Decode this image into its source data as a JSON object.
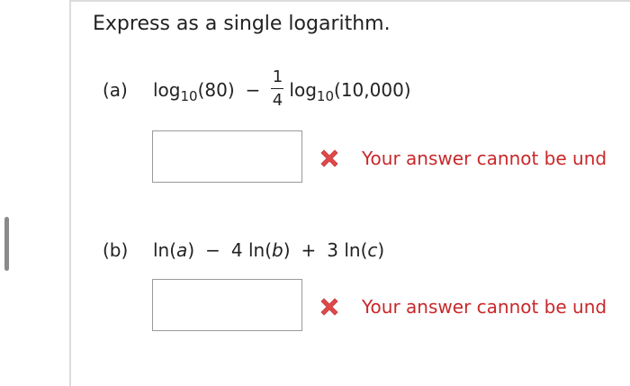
{
  "instruction": "Express as a single logarithm.",
  "problems": [
    {
      "label": "(a)",
      "expr": {
        "fn1": "log",
        "sub1": "10",
        "arg1": "(80)",
        "op": "−",
        "frac_num": "1",
        "frac_den": "4",
        "fn2": "log",
        "sub2": "10",
        "arg2": "(10,000)"
      },
      "answer_value": "",
      "feedback": "Your answer cannot be und"
    },
    {
      "label": "(b)",
      "expr": {
        "t1_fn": "ln(",
        "t1_var": "a",
        "t1_close": ")",
        "op1": "−",
        "t2_coef": "4 ln(",
        "t2_var": "b",
        "t2_close": ")",
        "op2": "+",
        "t3_coef": "3 ln(",
        "t3_var": "c",
        "t3_close": ")"
      },
      "answer_value": "",
      "feedback": "Your answer cannot be und"
    }
  ],
  "colors": {
    "error": "#c8282b",
    "icon": "#e0494b",
    "border": "#9a9a9a",
    "rule": "#dcdcdc"
  },
  "icons": {
    "feedback": "x-mark-icon"
  }
}
